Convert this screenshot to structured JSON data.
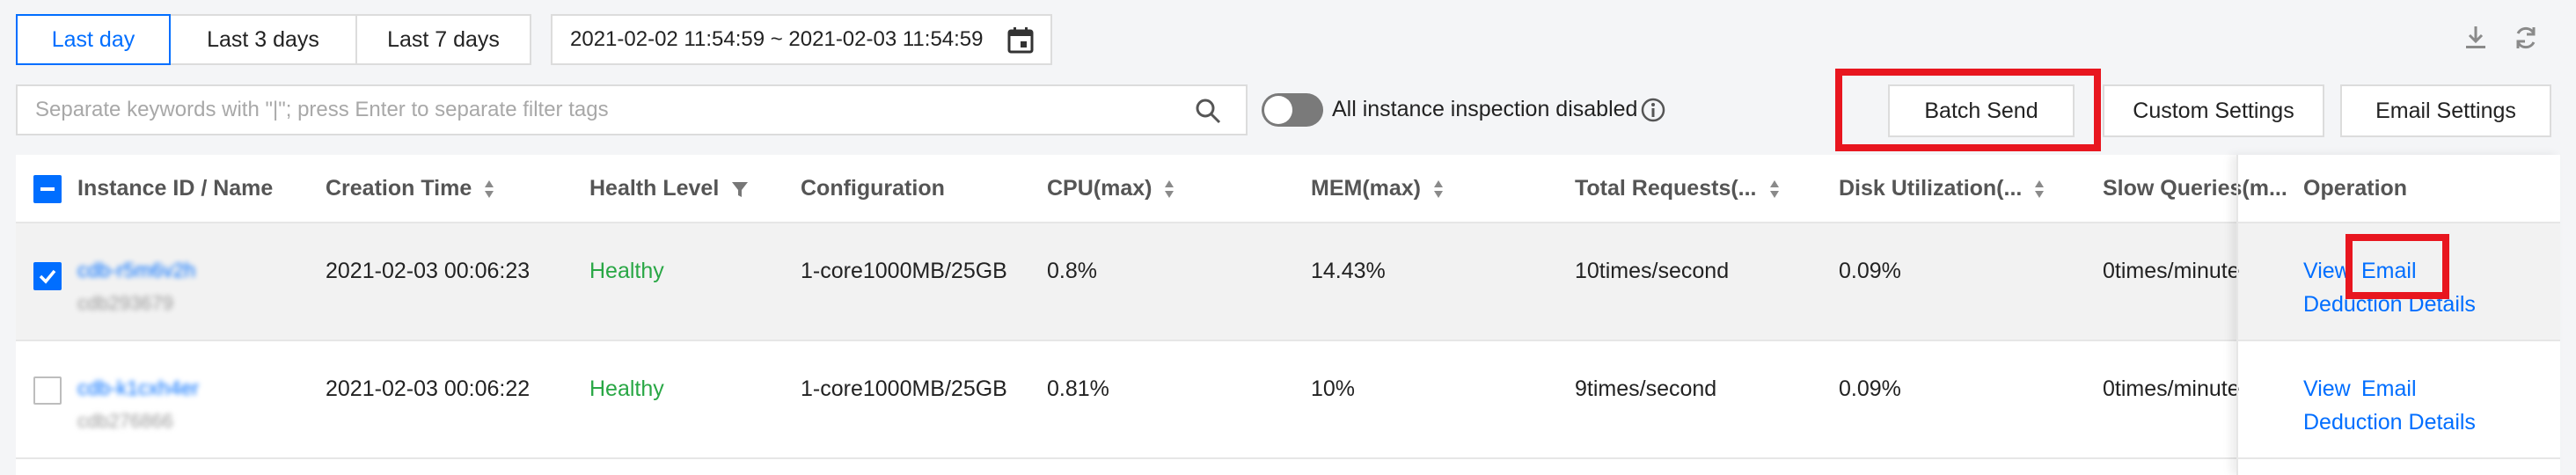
{
  "time_range": {
    "tabs": [
      {
        "label": "Last day",
        "active": true
      },
      {
        "label": "Last 3 days",
        "active": false
      },
      {
        "label": "Last 7 days",
        "active": false
      }
    ],
    "date_range": "2021-02-02 11:54:59 ~ 2021-02-03 11:54:59"
  },
  "toolbar_icons": [
    "download-icon",
    "refresh-icon",
    "calendar-icon",
    "search-icon",
    "info-icon"
  ],
  "search": {
    "placeholder": "Separate keywords with \"|\"; press Enter to separate filter tags"
  },
  "inspection": {
    "label": "All instance inspection disabled",
    "enabled": false
  },
  "actions": {
    "batch_send": "Batch Send",
    "custom_settings": "Custom Settings",
    "email_settings": "Email Settings"
  },
  "table": {
    "headers": [
      "Instance ID / Name",
      "Creation Time",
      "Health Level",
      "Configuration",
      "CPU(max)",
      "MEM(max)",
      "Total Requests(...",
      "Disk Utilization(...",
      "Slow Queries(m...",
      "Operation"
    ],
    "rows": [
      {
        "checked": true,
        "id": "cdb-r5m6v2h",
        "name": "cdb293679",
        "creation_time": "2021-02-03 00:06:23",
        "health": "Healthy",
        "configuration": "1-core1000MB/25GB",
        "cpu": "0.8%",
        "mem": "14.43%",
        "total_requests": "10times/second",
        "disk": "0.09%",
        "slow_queries": "0times/minute",
        "ops": {
          "view": "View",
          "email": "Email",
          "deduction": "Deduction Details"
        }
      },
      {
        "checked": false,
        "id": "cdb-k1cxh4er",
        "name": "cdb276866",
        "creation_time": "2021-02-03 00:06:22",
        "health": "Healthy",
        "configuration": "1-core1000MB/25GB",
        "cpu": "0.81%",
        "mem": "10%",
        "total_requests": "9times/second",
        "disk": "0.09%",
        "slow_queries": "0times/minute",
        "ops": {
          "view": "View",
          "email": "Email",
          "deduction": "Deduction Details"
        }
      }
    ]
  },
  "colors": {
    "accent": "#006eff",
    "healthy": "#29a745",
    "highlight": "#e8161f"
  }
}
